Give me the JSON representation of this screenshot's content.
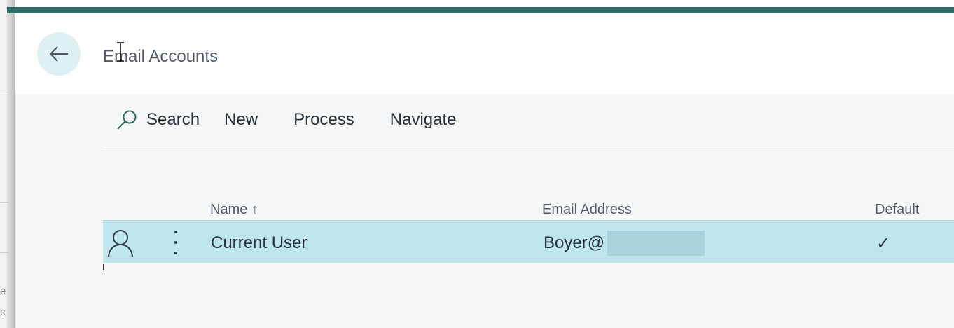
{
  "background": {
    "fragment_top": "e",
    "fragment_bottom": "c"
  },
  "header": {
    "title": "Email Accounts",
    "back_icon": "arrow-left-icon"
  },
  "actions": {
    "search_label": "Search",
    "new_label": "New",
    "process_label": "Process",
    "navigate_label": "Navigate"
  },
  "grid": {
    "columns": {
      "name": "Name ↑",
      "email": "Email Address",
      "default": "Default"
    },
    "rows": [
      {
        "icon": "user-icon",
        "name": "Current User",
        "email": "Boyer@",
        "default": "✓"
      }
    ]
  },
  "colors": {
    "accent": "#2e6e63",
    "selected_row": "#bee6ec",
    "back_button": "#dff0f3"
  }
}
